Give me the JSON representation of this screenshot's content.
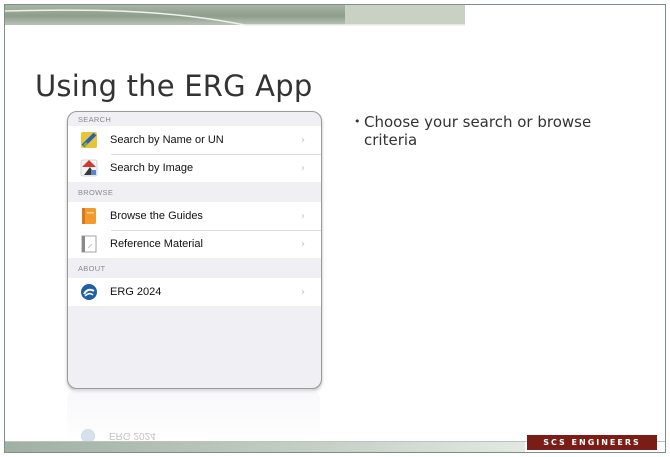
{
  "slide": {
    "title": "Using the ERG App",
    "bullets": [
      "Choose your search or browse criteria"
    ]
  },
  "app": {
    "sections": [
      {
        "header": "SEARCH",
        "rows": [
          {
            "label": "Search by Name or UN",
            "icon": "search-name-icon"
          },
          {
            "label": "Search by Image",
            "icon": "search-image-icon"
          }
        ]
      },
      {
        "header": "BROWSE",
        "rows": [
          {
            "label": "Browse the Guides",
            "icon": "guides-icon"
          },
          {
            "label": "Reference Material",
            "icon": "reference-icon"
          }
        ]
      },
      {
        "header": "ABOUT",
        "rows": [
          {
            "label": "ERG 2024",
            "icon": "dot-logo-icon"
          }
        ]
      }
    ],
    "chevron": "›",
    "reflection_label": "ERG 2024"
  },
  "footer": {
    "brand": "SCS ENGINEERS"
  },
  "colors": {
    "brand": "#7a1d17",
    "accent_band": "#8e9d8c",
    "dot_blue": "#1f5fa8"
  }
}
